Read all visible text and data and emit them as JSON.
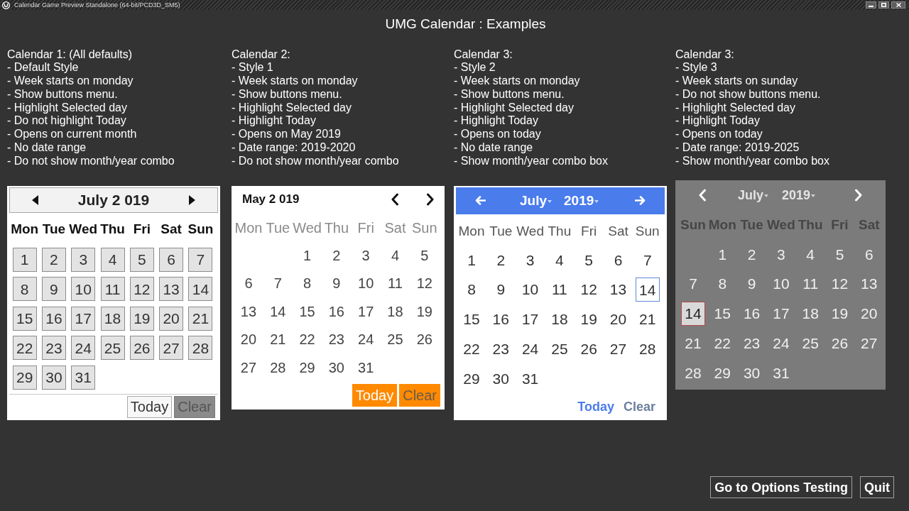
{
  "window": {
    "title": "Calendar Game Preview Standalone (64-bit/PCD3D_SM5)"
  },
  "heading": "UMG Calendar : Examples",
  "examples": [
    {
      "description": [
        "Calendar 1: (All defaults)",
        "- Default Style",
        "- Week starts on monday",
        "- Show buttons menu.",
        "- Highlight Selected day",
        "- Do not highlight Today",
        "- Opens on current month",
        "- No date range",
        "- Do not show month/year combo"
      ],
      "calendar": {
        "header": {
          "title": "July 2 019"
        },
        "weekdays": [
          "Mon",
          "Tue",
          "Wed",
          "Thu",
          "Fri",
          "Sat",
          "Sun"
        ],
        "weeks": [
          [
            {
              "day": "1",
              "today": false
            },
            {
              "day": "2",
              "today": false
            },
            {
              "day": "3",
              "today": false
            },
            {
              "day": "4",
              "today": false
            },
            {
              "day": "5",
              "today": false
            },
            {
              "day": "6",
              "today": false
            },
            {
              "day": "7",
              "today": false
            }
          ],
          [
            {
              "day": "8",
              "today": false
            },
            {
              "day": "9",
              "today": false
            },
            {
              "day": "10",
              "today": false
            },
            {
              "day": "11",
              "today": false
            },
            {
              "day": "12",
              "today": false
            },
            {
              "day": "13",
              "today": false
            },
            {
              "day": "14",
              "today": false
            }
          ],
          [
            {
              "day": "15",
              "today": false
            },
            {
              "day": "16",
              "today": false
            },
            {
              "day": "17",
              "today": false
            },
            {
              "day": "18",
              "today": false
            },
            {
              "day": "19",
              "today": false
            },
            {
              "day": "20",
              "today": false
            },
            {
              "day": "21",
              "today": false
            }
          ],
          [
            {
              "day": "22",
              "today": false
            },
            {
              "day": "23",
              "today": false
            },
            {
              "day": "24",
              "today": false
            },
            {
              "day": "25",
              "today": false
            },
            {
              "day": "26",
              "today": false
            },
            {
              "day": "27",
              "today": false
            },
            {
              "day": "28",
              "today": false
            }
          ],
          [
            {
              "day": "29",
              "today": false
            },
            {
              "day": "30",
              "today": false
            },
            {
              "day": "31",
              "today": false
            }
          ]
        ],
        "footer": {
          "today_button": {
            "label": "Today",
            "disabled": false
          },
          "clear_button": {
            "label": "Clear",
            "disabled": true
          }
        }
      }
    },
    {
      "description": [
        "Calendar 2:",
        "- Style 1",
        "- Week starts on monday",
        "- Show buttons menu.",
        "- Highlight Selected day",
        "- Highlight Today",
        "- Opens on May 2019",
        "- Date range: 2019-2020",
        "- Do not show month/year combo"
      ],
      "calendar": {
        "header": {
          "title": "May 2 019"
        },
        "weekdays": [
          "Mon",
          "Tue",
          "Wed",
          "Thu",
          "Fri",
          "Sat",
          "Sun"
        ],
        "weeks": [
          [
            {
              "day": "1",
              "today": false
            },
            {
              "day": "2",
              "today": false
            },
            {
              "day": "3",
              "today": false
            },
            {
              "day": "4",
              "today": false
            },
            {
              "day": "5",
              "today": false
            }
          ],
          [
            {
              "day": "6",
              "today": false
            },
            {
              "day": "7",
              "today": false
            },
            {
              "day": "8",
              "today": false
            },
            {
              "day": "9",
              "today": false
            },
            {
              "day": "10",
              "today": false
            },
            {
              "day": "11",
              "today": false
            },
            {
              "day": "12",
              "today": false
            }
          ],
          [
            {
              "day": "13",
              "today": false
            },
            {
              "day": "14",
              "today": false
            },
            {
              "day": "15",
              "today": false
            },
            {
              "day": "16",
              "today": false
            },
            {
              "day": "17",
              "today": false
            },
            {
              "day": "18",
              "today": false
            },
            {
              "day": "19",
              "today": false
            }
          ],
          [
            {
              "day": "20",
              "today": false
            },
            {
              "day": "21",
              "today": false
            },
            {
              "day": "22",
              "today": false
            },
            {
              "day": "23",
              "today": false
            },
            {
              "day": "24",
              "today": false
            },
            {
              "day": "25",
              "today": false
            },
            {
              "day": "26",
              "today": false
            }
          ],
          [
            {
              "day": "27",
              "today": false
            },
            {
              "day": "28",
              "today": false
            },
            {
              "day": "29",
              "today": false
            },
            {
              "day": "30",
              "today": false
            },
            {
              "day": "31",
              "today": false
            }
          ]
        ],
        "footer": {
          "today_button": {
            "label": "Today",
            "disabled": false
          },
          "clear_button": {
            "label": "Clear",
            "disabled": true
          }
        }
      }
    },
    {
      "description": [
        "Calendar 3:",
        "- Style 2",
        "- Week starts on monday",
        "- Show buttons menu.",
        "- Highlight Selected day",
        "- Highlight Today",
        "- Opens on today",
        "- No date range",
        "- Show month/year combo box"
      ],
      "calendar": {
        "header": {
          "month": "July",
          "year": "2019"
        },
        "weekdays": [
          "Mon",
          "Tue",
          "Wed",
          "Thu",
          "Fri",
          "Sat",
          "Sun"
        ],
        "weeks": [
          [
            {
              "day": "1",
              "today": false
            },
            {
              "day": "2",
              "today": false
            },
            {
              "day": "3",
              "today": false
            },
            {
              "day": "4",
              "today": false
            },
            {
              "day": "5",
              "today": false
            },
            {
              "day": "6",
              "today": false
            },
            {
              "day": "7",
              "today": false
            }
          ],
          [
            {
              "day": "8",
              "today": false
            },
            {
              "day": "9",
              "today": false
            },
            {
              "day": "10",
              "today": false
            },
            {
              "day": "11",
              "today": false
            },
            {
              "day": "12",
              "today": false
            },
            {
              "day": "13",
              "today": false
            },
            {
              "day": "14",
              "today": true
            }
          ],
          [
            {
              "day": "15",
              "today": false
            },
            {
              "day": "16",
              "today": false
            },
            {
              "day": "17",
              "today": false
            },
            {
              "day": "18",
              "today": false
            },
            {
              "day": "19",
              "today": false
            },
            {
              "day": "20",
              "today": false
            },
            {
              "day": "21",
              "today": false
            }
          ],
          [
            {
              "day": "22",
              "today": false
            },
            {
              "day": "23",
              "today": false
            },
            {
              "day": "24",
              "today": false
            },
            {
              "day": "25",
              "today": false
            },
            {
              "day": "26",
              "today": false
            },
            {
              "day": "27",
              "today": false
            },
            {
              "day": "28",
              "today": false
            }
          ],
          [
            {
              "day": "29",
              "today": false
            },
            {
              "day": "30",
              "today": false
            },
            {
              "day": "31",
              "today": false
            }
          ]
        ],
        "footer": {
          "today_button": {
            "label": "Today",
            "disabled": false
          },
          "clear_button": {
            "label": "Clear",
            "disabled": true
          }
        }
      }
    },
    {
      "description": [
        "Calendar 3:",
        "- Style 3",
        "- Week starts on sunday",
        "- Do not show buttons menu.",
        "- Highlight Selected day",
        "- Highlight Today",
        "- Opens on today",
        "- Date range: 2019-2025",
        "- Show month/year combo box"
      ],
      "calendar": {
        "header": {
          "month": "July",
          "year": "2019"
        },
        "weekdays": [
          "Sun",
          "Mon",
          "Tue",
          "Wed",
          "Thu",
          "Fri",
          "Sat"
        ],
        "weeks": [
          [
            {
              "day": "1",
              "today": false
            },
            {
              "day": "2",
              "today": false
            },
            {
              "day": "3",
              "today": false
            },
            {
              "day": "4",
              "today": false
            },
            {
              "day": "5",
              "today": false
            },
            {
              "day": "6",
              "today": false
            }
          ],
          [
            {
              "day": "7",
              "today": false
            },
            {
              "day": "8",
              "today": false
            },
            {
              "day": "9",
              "today": false
            },
            {
              "day": "10",
              "today": false
            },
            {
              "day": "11",
              "today": false
            },
            {
              "day": "12",
              "today": false
            },
            {
              "day": "13",
              "today": false
            }
          ],
          [
            {
              "day": "14",
              "today": true
            },
            {
              "day": "15",
              "today": false
            },
            {
              "day": "16",
              "today": false
            },
            {
              "day": "17",
              "today": false
            },
            {
              "day": "18",
              "today": false
            },
            {
              "day": "19",
              "today": false
            },
            {
              "day": "20",
              "today": false
            }
          ],
          [
            {
              "day": "21",
              "today": false
            },
            {
              "day": "22",
              "today": false
            },
            {
              "day": "23",
              "today": false
            },
            {
              "day": "24",
              "today": false
            },
            {
              "day": "25",
              "today": false
            },
            {
              "day": "26",
              "today": false
            },
            {
              "day": "27",
              "today": false
            }
          ],
          [
            {
              "day": "28",
              "today": false
            },
            {
              "day": "29",
              "today": false
            },
            {
              "day": "30",
              "today": false
            },
            {
              "day": "31",
              "today": false
            }
          ]
        ]
      }
    }
  ],
  "options_button": {
    "label": "Go to Options Testing"
  },
  "quit_button": {
    "label": "Quit"
  }
}
